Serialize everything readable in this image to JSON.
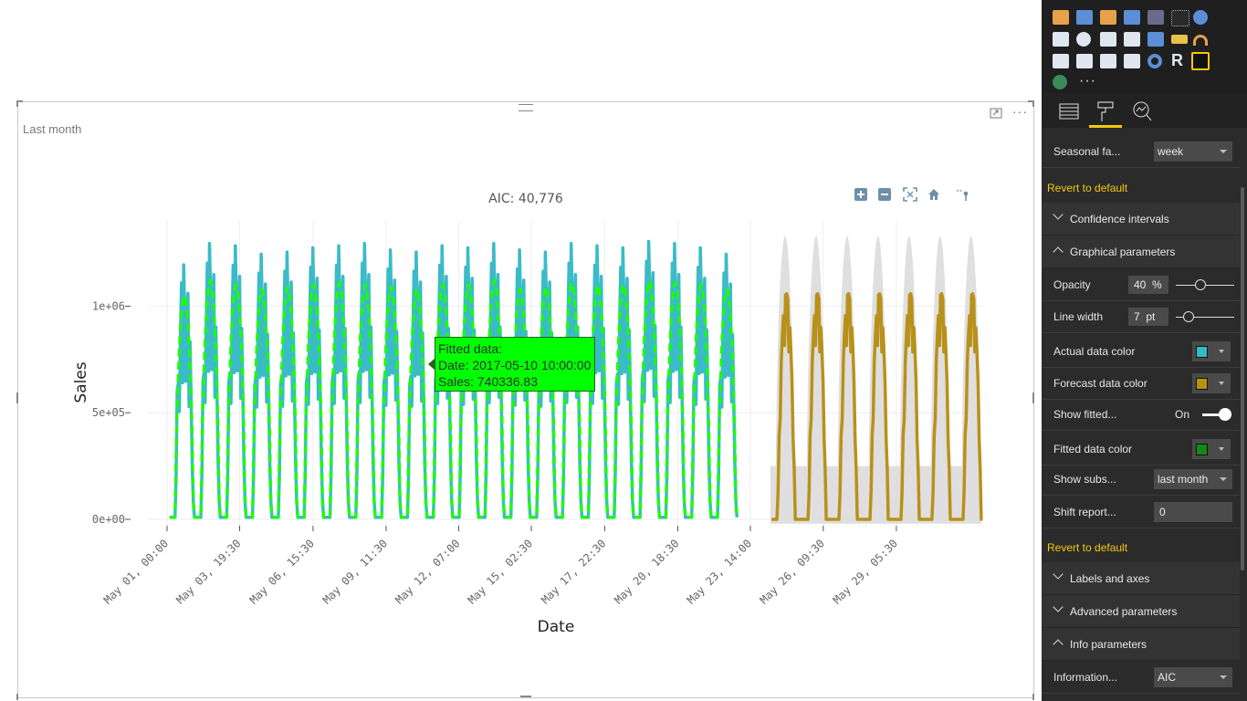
{
  "visual": {
    "subtitle": "Last month",
    "more_options": "···",
    "focus_mode_icon": "focus-mode-icon"
  },
  "chart_data": {
    "type": "line",
    "title": "AIC: 40,776",
    "xlabel": "Date",
    "ylabel": "Sales",
    "y_ticks": [
      "0e+00",
      "5e+05",
      "1e+06"
    ],
    "x_ticks": [
      "May 01, 00:00",
      "May 03, 19:30",
      "May 06, 15:30",
      "May 09, 11:30",
      "May 12, 07:00",
      "May 15, 02:30",
      "May 17, 22:30",
      "May 20, 18:30",
      "May 23, 14:00",
      "May 26, 09:30",
      "May 29, 05:30"
    ],
    "ylim": [
      -30000,
      1400000
    ],
    "grid": true,
    "series": [
      {
        "name": "Actual data",
        "color": "#3bbbc7",
        "x_range": [
          "May 01",
          "May 22"
        ],
        "daily_peaks": [
          1200000,
          1300000,
          1290000,
          1250000,
          1260000,
          1280000,
          1290000,
          1300000,
          1270000,
          1260000,
          1290000,
          1280000,
          1300000,
          1270000,
          1260000,
          1300000,
          1290000,
          1280000,
          1310000,
          1300000,
          1280000,
          1250000
        ]
      },
      {
        "name": "Fitted data",
        "color": "#1aff00",
        "x_range": [
          "May 01",
          "May 22"
        ],
        "daily_peaks": [
          1050000,
          1120000,
          1100000,
          1080000,
          1090000,
          1100000,
          1110000,
          1100000,
          1090000,
          1080000,
          1100000,
          1100000,
          1120000,
          1080000,
          1090000,
          1110000,
          1100000,
          1100000,
          1120000,
          1110000,
          1100000,
          1080000
        ]
      },
      {
        "name": "Forecast data",
        "color": "#b8911a",
        "x_range": [
          "May 22",
          "May 30"
        ],
        "daily_peaks": [
          1060000,
          1060000,
          1060000,
          1060000,
          1060000,
          1060000,
          1060000
        ]
      }
    ],
    "tooltip": {
      "line1": "Fitted data:",
      "line2": "Date: 2017-05-10 10:00:00",
      "line3": "Sales: 740336.83"
    },
    "modebar": [
      "zoom-in-icon",
      "zoom-out-icon",
      "autoscale-icon",
      "reset-axes-home-icon",
      "toggle-spike-lines-icon"
    ]
  },
  "pane": {
    "tabs": [
      "fields-tab-icon",
      "format-tab-icon",
      "analytics-tab-icon"
    ],
    "seasonal_label": "Seasonal fa...",
    "seasonal_value": "week",
    "revert1": "Revert to default",
    "confidence": "Confidence intervals",
    "graphical": "Graphical parameters",
    "opacity_label": "Opacity",
    "opacity_value": "40",
    "opacity_unit": "%",
    "opacity_level": 0.4,
    "linewidth_label": "Line width",
    "linewidth_value": "7",
    "linewidth_unit": "pt",
    "actual_color_label": "Actual data color",
    "actual_color": "#2fbcc4",
    "forecast_color_label": "Forecast data color",
    "forecast_color": "#b8930d",
    "show_fitted_label": "Show fitted...",
    "show_fitted_value": "On",
    "fitted_color_label": "Fitted data color",
    "fitted_color": "#138a13",
    "show_subs_label": "Show subs...",
    "show_subs_value": "last month",
    "shift_label": "Shift report...",
    "shift_value": "0",
    "revert2": "Revert to default",
    "labels_axes": "Labels and axes",
    "advanced": "Advanced parameters",
    "info": "Info parameters",
    "information_label": "Information...",
    "information_value": "AIC"
  }
}
